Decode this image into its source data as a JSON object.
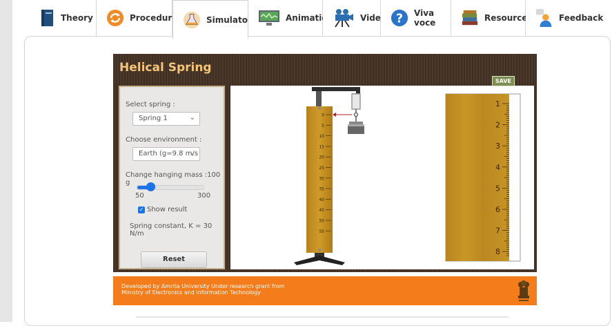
{
  "tabs": [
    {
      "label": "Theory",
      "icon": "book-icon"
    },
    {
      "label": "Procedure",
      "icon": "cycle-arrows-icon"
    },
    {
      "label": "Simulator",
      "icon": "flask-icon",
      "active": true
    },
    {
      "label": "Animation",
      "icon": "monitor-icon"
    },
    {
      "label": "Video",
      "icon": "video-camera-icon"
    },
    {
      "label": "Viva voce",
      "icon": "question-icon"
    },
    {
      "label": "Resources",
      "icon": "books-icon"
    },
    {
      "label": "Feedback",
      "icon": "person-chat-icon"
    }
  ],
  "simulator": {
    "title": "Helical Spring",
    "save_label": "SAVE",
    "select_spring_label": "Select spring :",
    "spring_value": "Spring 1",
    "environment_label": "Choose environment :",
    "environment_value": "Earth (g=9.8 m/s",
    "mass_label": "Change hanging mass :",
    "mass_value": "100 g",
    "slider_min": "50",
    "slider_max": "300",
    "slider_fraction": 0.2,
    "show_result_label": "Show result",
    "show_result_checked": true,
    "result_text": "Spring constant, K = 30 N/m",
    "reset_label": "Reset",
    "scale_ticks": [
      "0",
      "5",
      "10",
      "15",
      "20",
      "25",
      "30",
      "35",
      "40",
      "45",
      "50",
      "55"
    ],
    "ruler_numbers": [
      "1",
      "2",
      "3",
      "4",
      "5",
      "6",
      "7",
      "8"
    ]
  },
  "footer": {
    "line1": "Developed by Amrita University Under research grant from",
    "line2": "Ministry of Electronics and Information Technology"
  },
  "colors": {
    "header_brown": "#45352a",
    "title_gold": "#f3c47a",
    "footer_orange": "#f47c1b",
    "accent_blue": "#1a73e8",
    "wood": "#c8951f"
  }
}
